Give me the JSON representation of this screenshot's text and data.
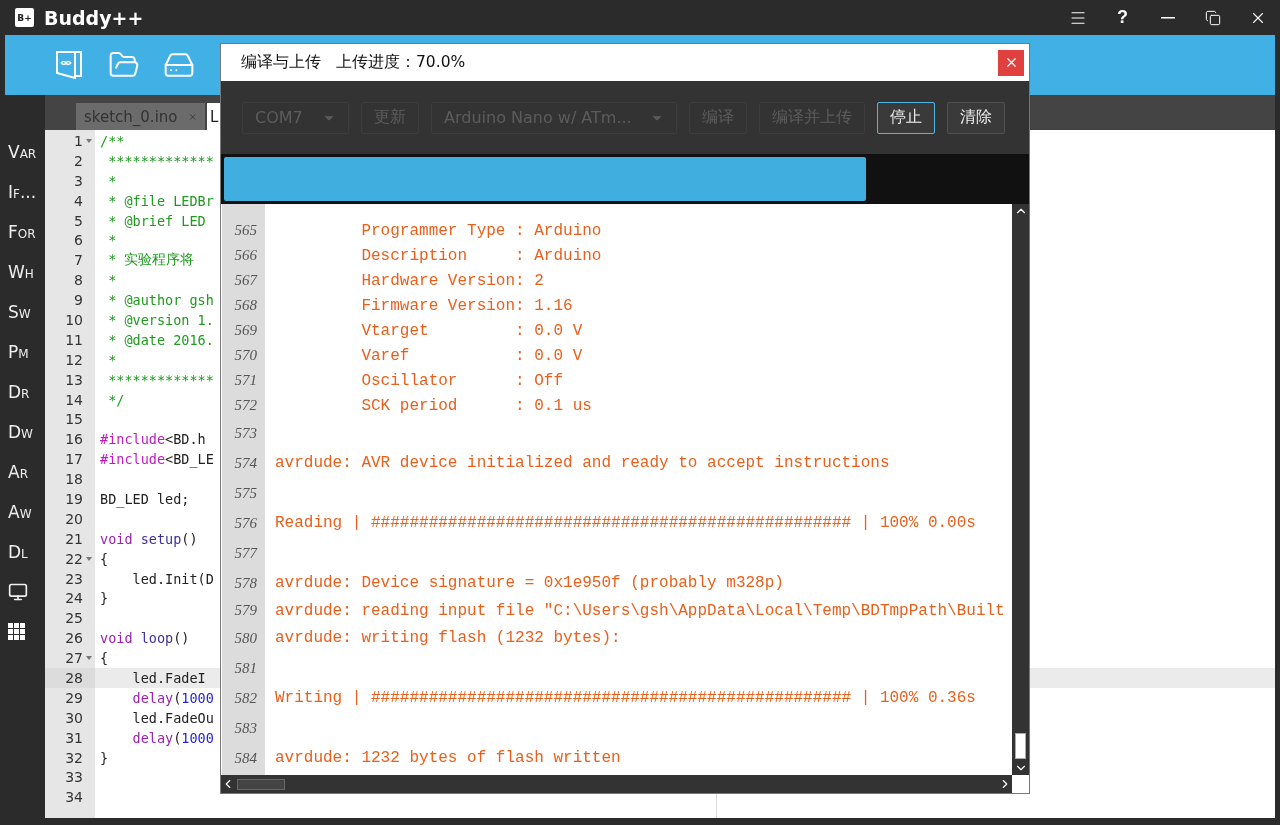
{
  "window": {
    "logo": "B+",
    "title": "Buddy++",
    "controls": [
      {
        "kind": "menu"
      },
      {
        "kind": "help",
        "label": "?"
      },
      {
        "kind": "minimize"
      },
      {
        "kind": "restore"
      },
      {
        "kind": "close"
      }
    ]
  },
  "toolbar": [
    {
      "kind": "board-book"
    },
    {
      "kind": "folder"
    },
    {
      "kind": "drive"
    }
  ],
  "sidebar": [
    {
      "kind": "text",
      "label": "Var"
    },
    {
      "kind": "text",
      "label": "If..."
    },
    {
      "kind": "text",
      "label": "For"
    },
    {
      "kind": "text",
      "label": "Wh"
    },
    {
      "kind": "text",
      "label": "Sw"
    },
    {
      "kind": "text",
      "label": "Pm"
    },
    {
      "kind": "text",
      "label": "Dr"
    },
    {
      "kind": "text",
      "label": "Dw"
    },
    {
      "kind": "text",
      "label": "Ar"
    },
    {
      "kind": "text",
      "label": "Aw"
    },
    {
      "kind": "text",
      "label": "Dl"
    },
    {
      "kind": "monitor"
    },
    {
      "kind": "grid"
    }
  ],
  "tabs": [
    {
      "label": "sketch_0.ino",
      "selected": false,
      "closable": true
    },
    {
      "label": "L",
      "selected": true,
      "closable": false
    }
  ],
  "editor": {
    "lines": [
      {
        "number": "1",
        "fold": true,
        "current": false,
        "tokens": [
          {
            "kind": "comment",
            "text": "/**"
          }
        ]
      },
      {
        "number": "2",
        "fold": false,
        "current": false,
        "tokens": [
          {
            "kind": "comment",
            "text": " *************"
          }
        ]
      },
      {
        "number": "3",
        "fold": false,
        "current": false,
        "tokens": [
          {
            "kind": "comment",
            "text": " *"
          }
        ]
      },
      {
        "number": "4",
        "fold": false,
        "current": false,
        "tokens": [
          {
            "kind": "comment",
            "text": " * @file LEDBr"
          }
        ]
      },
      {
        "number": "5",
        "fold": false,
        "current": false,
        "tokens": [
          {
            "kind": "comment",
            "text": " * @brief LED"
          }
        ]
      },
      {
        "number": "6",
        "fold": false,
        "current": false,
        "tokens": [
          {
            "kind": "comment",
            "text": " *"
          }
        ]
      },
      {
        "number": "7",
        "fold": false,
        "current": false,
        "tokens": [
          {
            "kind": "comment",
            "text": " * 实验程序将"
          }
        ]
      },
      {
        "number": "8",
        "fold": false,
        "current": false,
        "tokens": [
          {
            "kind": "comment",
            "text": " *"
          }
        ]
      },
      {
        "number": "9",
        "fold": false,
        "current": false,
        "tokens": [
          {
            "kind": "comment",
            "text": " * @author gsh"
          }
        ]
      },
      {
        "number": "10",
        "fold": false,
        "current": false,
        "tokens": [
          {
            "kind": "comment",
            "text": " * @version 1."
          }
        ]
      },
      {
        "number": "11",
        "fold": false,
        "current": false,
        "tokens": [
          {
            "kind": "comment",
            "text": " * @date 2016."
          }
        ]
      },
      {
        "number": "12",
        "fold": false,
        "current": false,
        "tokens": [
          {
            "kind": "comment",
            "text": " *"
          }
        ]
      },
      {
        "number": "13",
        "fold": false,
        "current": false,
        "tokens": [
          {
            "kind": "comment",
            "text": " *************"
          }
        ]
      },
      {
        "number": "14",
        "fold": false,
        "current": false,
        "tokens": [
          {
            "kind": "comment",
            "text": " */"
          }
        ]
      },
      {
        "number": "15",
        "fold": false,
        "current": false
      },
      {
        "number": "16",
        "fold": false,
        "current": false,
        "tokens": [
          {
            "kind": "directive",
            "text": "#include"
          },
          {
            "kind": "plain",
            "text": "<BD.h"
          }
        ]
      },
      {
        "number": "17",
        "fold": false,
        "current": false,
        "tokens": [
          {
            "kind": "directive",
            "text": "#include"
          },
          {
            "kind": "plain",
            "text": "<BD_LE"
          }
        ]
      },
      {
        "number": "18",
        "fold": false,
        "current": false
      },
      {
        "number": "19",
        "fold": false,
        "current": false,
        "tokens": [
          {
            "kind": "plain",
            "text": "BD_LED led;"
          }
        ]
      },
      {
        "number": "20",
        "fold": false,
        "current": false
      },
      {
        "number": "21",
        "fold": false,
        "current": false,
        "tokens": [
          {
            "kind": "keyword",
            "text": "void"
          },
          {
            "kind": "function",
            "text": " setup"
          },
          {
            "kind": "plain",
            "text": "()"
          }
        ]
      },
      {
        "number": "22",
        "fold": true,
        "current": false,
        "tokens": [
          {
            "kind": "plain",
            "text": "{"
          }
        ]
      },
      {
        "number": "23",
        "fold": false,
        "current": false,
        "tokens": [
          {
            "kind": "plain",
            "text": "    led.Init(D"
          }
        ]
      },
      {
        "number": "24",
        "fold": false,
        "current": false,
        "tokens": [
          {
            "kind": "plain",
            "text": "}"
          }
        ]
      },
      {
        "number": "25",
        "fold": false,
        "current": false
      },
      {
        "number": "26",
        "fold": false,
        "current": false,
        "tokens": [
          {
            "kind": "keyword",
            "text": "void"
          },
          {
            "kind": "function",
            "text": " loop"
          },
          {
            "kind": "plain",
            "text": "()"
          }
        ]
      },
      {
        "number": "27",
        "fold": true,
        "current": false,
        "tokens": [
          {
            "kind": "plain",
            "text": "{"
          }
        ]
      },
      {
        "number": "28",
        "fold": false,
        "current": true,
        "tokens": [
          {
            "kind": "plain",
            "text": "    led.FadeI"
          }
        ]
      },
      {
        "number": "29",
        "fold": false,
        "current": false,
        "tokens": [
          {
            "kind": "keyword",
            "text": "    delay"
          },
          {
            "kind": "plain",
            "text": "("
          },
          {
            "kind": "number",
            "text": "1000"
          }
        ]
      },
      {
        "number": "30",
        "fold": false,
        "current": false,
        "tokens": [
          {
            "kind": "plain",
            "text": "    led.FadeOu"
          }
        ]
      },
      {
        "number": "31",
        "fold": false,
        "current": false,
        "tokens": [
          {
            "kind": "keyword",
            "text": "    delay"
          },
          {
            "kind": "plain",
            "text": "("
          },
          {
            "kind": "number",
            "text": "1000"
          }
        ]
      },
      {
        "number": "32",
        "fold": false,
        "current": false,
        "tokens": [
          {
            "kind": "plain",
            "text": "}"
          }
        ]
      },
      {
        "number": "33",
        "fold": false,
        "current": false
      },
      {
        "number": "34",
        "fold": false,
        "current": false
      }
    ]
  },
  "dialog": {
    "title": "编译与上传",
    "status": "上传进度：70.0%",
    "controls": [
      {
        "kind": "select",
        "label": "COM7",
        "disabled": true,
        "focused": false
      },
      {
        "kind": "button",
        "label": "更新",
        "disabled": true,
        "focused": false
      },
      {
        "kind": "select",
        "label": "Arduino Nano w/ ATm...",
        "disabled": true,
        "focused": false
      },
      {
        "kind": "button",
        "label": "编译",
        "disabled": true,
        "focused": false
      },
      {
        "kind": "button",
        "label": "编译并上传",
        "disabled": true,
        "focused": false
      },
      {
        "kind": "button",
        "label": "停止",
        "disabled": false,
        "focused": true
      },
      {
        "kind": "button",
        "label": "清除",
        "disabled": false,
        "focused": false
      }
    ],
    "progress": {
      "level": 0.8
    },
    "log": [
      {
        "number": "565",
        "text": "         Programmer Type : Arduino"
      },
      {
        "number": "566",
        "text": "         Description     : Arduino"
      },
      {
        "number": "567",
        "text": "         Hardware Version: 2"
      },
      {
        "number": "568",
        "text": "         Firmware Version: 1.16"
      },
      {
        "number": "569",
        "text": "         Vtarget         : 0.0 V"
      },
      {
        "number": "570",
        "text": "         Varef           : 0.0 V"
      },
      {
        "number": "571",
        "text": "         Oscillator      : Off"
      },
      {
        "number": "572",
        "text": "         SCK period      : 0.1 us"
      },
      {
        "number": "573"
      },
      {
        "number": "574",
        "text": "avrdude: AVR device initialized and ready to accept instructions"
      },
      {
        "number": "575"
      },
      {
        "number": "576",
        "text": "Reading | ################################################## | 100% 0.00s"
      },
      {
        "number": "577"
      },
      {
        "number": "578",
        "text": "avrdude: Device signature = 0x1e950f (probably m328p)"
      },
      {
        "number": "579",
        "text": "avrdude: reading input file \"C:\\Users\\gsh\\AppData\\Local\\Temp\\BDTmpPath\\Built"
      },
      {
        "number": "580",
        "text": "avrdude: writing flash (1232 bytes):"
      },
      {
        "number": "581"
      },
      {
        "number": "582",
        "text": "Writing | ################################################## | 100% 0.36s"
      },
      {
        "number": "583"
      },
      {
        "number": "584",
        "text": "avrdude: 1232 bytes of flash written"
      }
    ]
  }
}
